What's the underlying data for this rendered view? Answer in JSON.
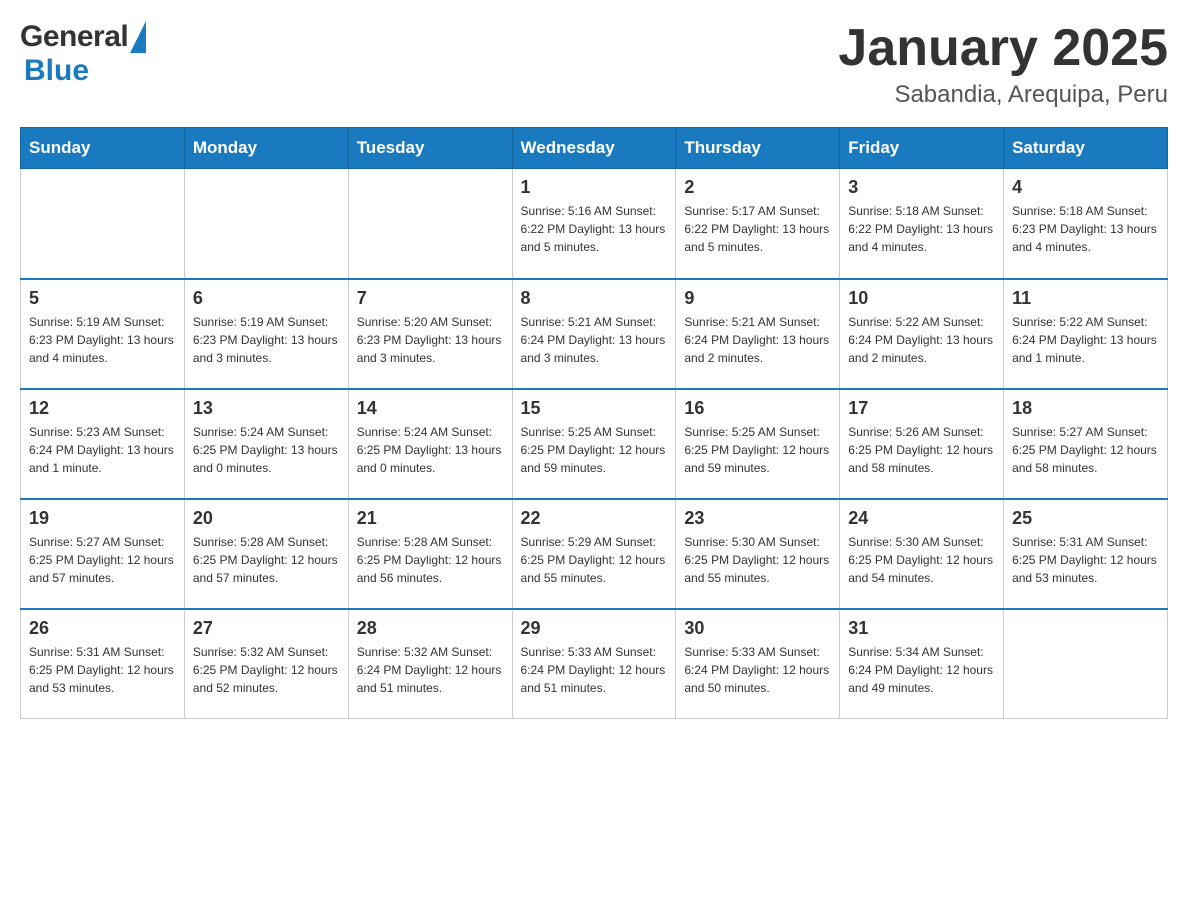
{
  "header": {
    "title": "January 2025",
    "subtitle": "Sabandia, Arequipa, Peru",
    "logo_general": "General",
    "logo_blue": "Blue"
  },
  "calendar": {
    "days_of_week": [
      "Sunday",
      "Monday",
      "Tuesday",
      "Wednesday",
      "Thursday",
      "Friday",
      "Saturday"
    ],
    "weeks": [
      [
        {
          "day": "",
          "info": ""
        },
        {
          "day": "",
          "info": ""
        },
        {
          "day": "",
          "info": ""
        },
        {
          "day": "1",
          "info": "Sunrise: 5:16 AM\nSunset: 6:22 PM\nDaylight: 13 hours\nand 5 minutes."
        },
        {
          "day": "2",
          "info": "Sunrise: 5:17 AM\nSunset: 6:22 PM\nDaylight: 13 hours\nand 5 minutes."
        },
        {
          "day": "3",
          "info": "Sunrise: 5:18 AM\nSunset: 6:22 PM\nDaylight: 13 hours\nand 4 minutes."
        },
        {
          "day": "4",
          "info": "Sunrise: 5:18 AM\nSunset: 6:23 PM\nDaylight: 13 hours\nand 4 minutes."
        }
      ],
      [
        {
          "day": "5",
          "info": "Sunrise: 5:19 AM\nSunset: 6:23 PM\nDaylight: 13 hours\nand 4 minutes."
        },
        {
          "day": "6",
          "info": "Sunrise: 5:19 AM\nSunset: 6:23 PM\nDaylight: 13 hours\nand 3 minutes."
        },
        {
          "day": "7",
          "info": "Sunrise: 5:20 AM\nSunset: 6:23 PM\nDaylight: 13 hours\nand 3 minutes."
        },
        {
          "day": "8",
          "info": "Sunrise: 5:21 AM\nSunset: 6:24 PM\nDaylight: 13 hours\nand 3 minutes."
        },
        {
          "day": "9",
          "info": "Sunrise: 5:21 AM\nSunset: 6:24 PM\nDaylight: 13 hours\nand 2 minutes."
        },
        {
          "day": "10",
          "info": "Sunrise: 5:22 AM\nSunset: 6:24 PM\nDaylight: 13 hours\nand 2 minutes."
        },
        {
          "day": "11",
          "info": "Sunrise: 5:22 AM\nSunset: 6:24 PM\nDaylight: 13 hours\nand 1 minute."
        }
      ],
      [
        {
          "day": "12",
          "info": "Sunrise: 5:23 AM\nSunset: 6:24 PM\nDaylight: 13 hours\nand 1 minute."
        },
        {
          "day": "13",
          "info": "Sunrise: 5:24 AM\nSunset: 6:25 PM\nDaylight: 13 hours\nand 0 minutes."
        },
        {
          "day": "14",
          "info": "Sunrise: 5:24 AM\nSunset: 6:25 PM\nDaylight: 13 hours\nand 0 minutes."
        },
        {
          "day": "15",
          "info": "Sunrise: 5:25 AM\nSunset: 6:25 PM\nDaylight: 12 hours\nand 59 minutes."
        },
        {
          "day": "16",
          "info": "Sunrise: 5:25 AM\nSunset: 6:25 PM\nDaylight: 12 hours\nand 59 minutes."
        },
        {
          "day": "17",
          "info": "Sunrise: 5:26 AM\nSunset: 6:25 PM\nDaylight: 12 hours\nand 58 minutes."
        },
        {
          "day": "18",
          "info": "Sunrise: 5:27 AM\nSunset: 6:25 PM\nDaylight: 12 hours\nand 58 minutes."
        }
      ],
      [
        {
          "day": "19",
          "info": "Sunrise: 5:27 AM\nSunset: 6:25 PM\nDaylight: 12 hours\nand 57 minutes."
        },
        {
          "day": "20",
          "info": "Sunrise: 5:28 AM\nSunset: 6:25 PM\nDaylight: 12 hours\nand 57 minutes."
        },
        {
          "day": "21",
          "info": "Sunrise: 5:28 AM\nSunset: 6:25 PM\nDaylight: 12 hours\nand 56 minutes."
        },
        {
          "day": "22",
          "info": "Sunrise: 5:29 AM\nSunset: 6:25 PM\nDaylight: 12 hours\nand 55 minutes."
        },
        {
          "day": "23",
          "info": "Sunrise: 5:30 AM\nSunset: 6:25 PM\nDaylight: 12 hours\nand 55 minutes."
        },
        {
          "day": "24",
          "info": "Sunrise: 5:30 AM\nSunset: 6:25 PM\nDaylight: 12 hours\nand 54 minutes."
        },
        {
          "day": "25",
          "info": "Sunrise: 5:31 AM\nSunset: 6:25 PM\nDaylight: 12 hours\nand 53 minutes."
        }
      ],
      [
        {
          "day": "26",
          "info": "Sunrise: 5:31 AM\nSunset: 6:25 PM\nDaylight: 12 hours\nand 53 minutes."
        },
        {
          "day": "27",
          "info": "Sunrise: 5:32 AM\nSunset: 6:25 PM\nDaylight: 12 hours\nand 52 minutes."
        },
        {
          "day": "28",
          "info": "Sunrise: 5:32 AM\nSunset: 6:24 PM\nDaylight: 12 hours\nand 51 minutes."
        },
        {
          "day": "29",
          "info": "Sunrise: 5:33 AM\nSunset: 6:24 PM\nDaylight: 12 hours\nand 51 minutes."
        },
        {
          "day": "30",
          "info": "Sunrise: 5:33 AM\nSunset: 6:24 PM\nDaylight: 12 hours\nand 50 minutes."
        },
        {
          "day": "31",
          "info": "Sunrise: 5:34 AM\nSunset: 6:24 PM\nDaylight: 12 hours\nand 49 minutes."
        },
        {
          "day": "",
          "info": ""
        }
      ]
    ]
  }
}
